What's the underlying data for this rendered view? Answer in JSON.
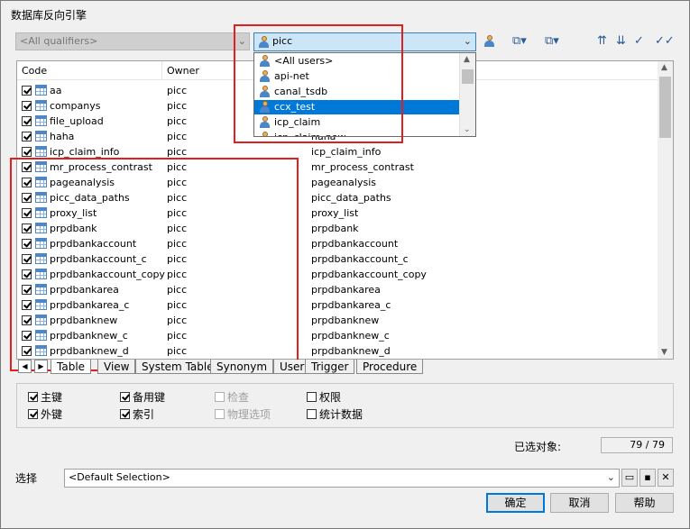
{
  "window": {
    "title": "数据库反向引擎"
  },
  "qualifier": {
    "value": "<All qualifiers>"
  },
  "owner": {
    "value": "picc",
    "options": [
      "<All users>",
      "api-net",
      "canal_tsdb",
      "ccx_test",
      "icp_claim",
      "icp_claim_new"
    ],
    "selected_option": "ccx_test"
  },
  "toolbar": {
    "icons": [
      "user-icon",
      "select-all-icon",
      "deselect-all-icon",
      "move-up-icon",
      "move-down-icon",
      "filter-icon",
      "check-all-icon"
    ]
  },
  "table": {
    "columns": [
      "Code",
      "Owner"
    ],
    "rows": [
      {
        "code": "aa",
        "owner": "picc",
        "name": ""
      },
      {
        "code": "companys",
        "owner": "picc",
        "name": ""
      },
      {
        "code": "file_upload",
        "owner": "picc",
        "name": ""
      },
      {
        "code": "haha",
        "owner": "picc",
        "name": "haha"
      },
      {
        "code": "icp_claim_info",
        "owner": "picc",
        "name": "icp_claim_info"
      },
      {
        "code": "mr_process_contrast",
        "owner": "picc",
        "name": "mr_process_contrast"
      },
      {
        "code": "pageanalysis",
        "owner": "picc",
        "name": "pageanalysis"
      },
      {
        "code": "picc_data_paths",
        "owner": "picc",
        "name": "picc_data_paths"
      },
      {
        "code": "proxy_list",
        "owner": "picc",
        "name": "proxy_list"
      },
      {
        "code": "prpdbank",
        "owner": "picc",
        "name": "prpdbank"
      },
      {
        "code": "prpdbankaccount",
        "owner": "picc",
        "name": "prpdbankaccount"
      },
      {
        "code": "prpdbankaccount_c",
        "owner": "picc",
        "name": "prpdbankaccount_c"
      },
      {
        "code": "prpdbankaccount_copy",
        "owner": "picc",
        "name": "prpdbankaccount_copy"
      },
      {
        "code": "prpdbankarea",
        "owner": "picc",
        "name": "prpdbankarea"
      },
      {
        "code": "prpdbankarea_c",
        "owner": "picc",
        "name": "prpdbankarea_c"
      },
      {
        "code": "prpdbanknew",
        "owner": "picc",
        "name": "prpdbanknew"
      },
      {
        "code": "prpdbanknew_c",
        "owner": "picc",
        "name": "prpdbanknew_c"
      },
      {
        "code": "prpdbanknew_d",
        "owner": "picc",
        "name": "prpdbanknew_d"
      }
    ]
  },
  "tabs": [
    "Table",
    "View",
    "System Table",
    "Synonym",
    "User",
    "Trigger",
    "Procedure"
  ],
  "options": {
    "primary_key": {
      "label": "主键",
      "checked": true
    },
    "foreign_key": {
      "label": "外键",
      "checked": true
    },
    "alternate_key": {
      "label": "备用键",
      "checked": true
    },
    "index": {
      "label": "索引",
      "checked": true
    },
    "check": {
      "label": "检查",
      "checked": false,
      "disabled": true
    },
    "physical_options": {
      "label": "物理选项",
      "checked": false,
      "disabled": true
    },
    "permissions": {
      "label": "权限",
      "checked": false
    },
    "statistics": {
      "label": "统计数据",
      "checked": false
    }
  },
  "selection_count": {
    "label": "已选对象:",
    "value": "79 / 79"
  },
  "selection": {
    "label": "选择",
    "value": "<Default Selection>"
  },
  "buttons": {
    "ok": "确定",
    "cancel": "取消",
    "help": "帮助"
  }
}
